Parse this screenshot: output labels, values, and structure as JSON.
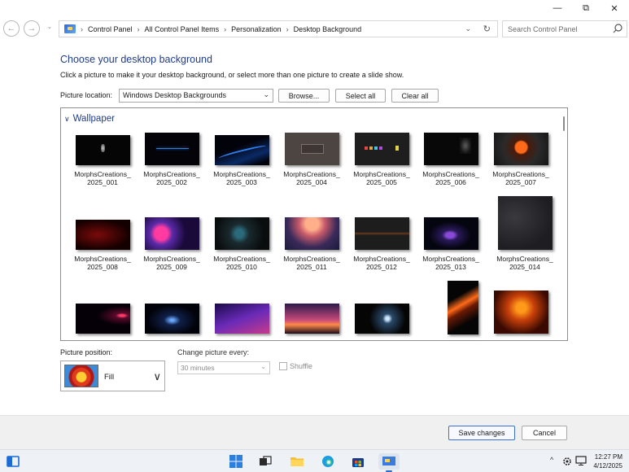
{
  "window": {
    "controls": {
      "minimize": "—",
      "maximize": "⧉",
      "close": "✕"
    }
  },
  "address_bar": {
    "breadcrumbs": [
      "Control Panel",
      "All Control Panel Items",
      "Personalization",
      "Desktop Background"
    ],
    "search_placeholder": "Search Control Panel"
  },
  "main": {
    "title": "Choose your desktop background",
    "instructions": "Click a picture to make it your desktop background, or select more than one picture to create a slide show.",
    "picture_location_label": "Picture location:",
    "picture_location_value": "Windows Desktop Backgrounds",
    "browse_label": "Browse...",
    "select_all_label": "Select all",
    "clear_all_label": "Clear all",
    "group_name": "Wallpaper",
    "wallpapers": [
      {
        "line1": "MorphsCreations_",
        "line2": "2025_001"
      },
      {
        "line1": "MorphsCreations_",
        "line2": "2025_002"
      },
      {
        "line1": "MorphsCreations_",
        "line2": "2025_003"
      },
      {
        "line1": "MorphsCreations_",
        "line2": "2025_004"
      },
      {
        "line1": "MorphsCreations_",
        "line2": "2025_005"
      },
      {
        "line1": "MorphsCreations_",
        "line2": "2025_006"
      },
      {
        "line1": "MorphsCreations_",
        "line2": "2025_007"
      },
      {
        "line1": "MorphsCreations_",
        "line2": "2025_008"
      },
      {
        "line1": "MorphsCreations_",
        "line2": "2025_009"
      },
      {
        "line1": "MorphsCreations_",
        "line2": "2025_010"
      },
      {
        "line1": "MorphsCreations_",
        "line2": "2025_011"
      },
      {
        "line1": "MorphsCreations_",
        "line2": "2025_012"
      },
      {
        "line1": "MorphsCreations_",
        "line2": "2025_013"
      },
      {
        "line1": "MorphsCreations_",
        "line2": "2025_014"
      }
    ],
    "picture_position_label": "Picture position:",
    "picture_position_value": "Fill",
    "change_every_label": "Change picture every:",
    "change_every_value": "30 minutes",
    "shuffle_label": "Shuffle"
  },
  "footer": {
    "save_label": "Save changes",
    "cancel_label": "Cancel"
  },
  "taskbar": {
    "time": "12:27 PM",
    "date": "4/12/2025",
    "tray_chevron": "^"
  }
}
